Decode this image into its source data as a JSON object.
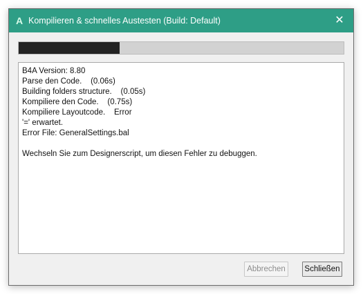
{
  "window": {
    "title": "Kompilieren & schnelles Austesten (Build: Default)",
    "app_icon_letter": "A",
    "close_glyph": "✕",
    "titlebar_color": "#2e9e86"
  },
  "progress": {
    "value_fraction": 0.31
  },
  "log": {
    "lines": [
      "B4A Version: 8.80",
      "Parse den Code.    (0.06s)",
      "Building folders structure.    (0.05s)",
      "Kompiliere den Code.    (0.75s)",
      "Kompiliere Layoutcode.    Error",
      "'=' erwartet.",
      "Error File: GeneralSettings.bal",
      "",
      "Wechseln Sie zum Designerscript, um diesen Fehler zu debuggen."
    ]
  },
  "buttons": {
    "cancel_label": "Abbrechen",
    "close_label": "Schließen"
  }
}
